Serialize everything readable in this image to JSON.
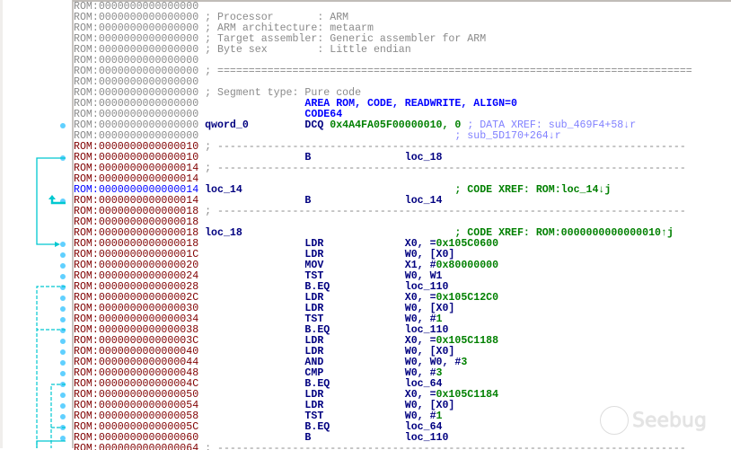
{
  "watermark": "Seebug",
  "colors": {
    "flow_arrow": "#00c8d0",
    "breakpoint_dot": "#60d0ff",
    "code_address": "#800000",
    "data_address": "#8a8a8a"
  },
  "listing": {
    "lines": [
      {
        "addr": "ROM:0000000000000000",
        "a": "gray"
      },
      {
        "addr": "ROM:0000000000000000",
        "a": "gray",
        "comment": "; Processor       : ARM"
      },
      {
        "addr": "ROM:0000000000000000",
        "a": "gray",
        "comment": "; ARM architecture: metaarm"
      },
      {
        "addr": "ROM:0000000000000000",
        "a": "gray",
        "comment": "; Target assembler: Generic assembler for ARM"
      },
      {
        "addr": "ROM:0000000000000000",
        "a": "gray",
        "comment": "; Byte sex        : Little endian"
      },
      {
        "addr": "ROM:0000000000000000",
        "a": "gray"
      },
      {
        "addr": "ROM:0000000000000000",
        "a": "gray",
        "comment": "; ============================================================================"
      },
      {
        "addr": "ROM:0000000000000000",
        "a": "gray"
      },
      {
        "addr": "ROM:0000000000000000",
        "a": "gray",
        "comment": "; Segment type: Pure code"
      },
      {
        "addr": "ROM:0000000000000000",
        "a": "gray",
        "directive": "AREA ROM, CODE, READWRITE, ALIGN=0"
      },
      {
        "addr": "ROM:0000000000000000",
        "a": "gray",
        "directive": "CODE64"
      },
      {
        "addr": "ROM:0000000000000000",
        "a": "gray",
        "label": "qword_0",
        "mnem": "DCQ",
        "data_ops": "0x4A4FA05F00000010, 0",
        "xref": "; DATA XREF: sub_469F4+58↓r",
        "xk": "xd",
        "xcol": 63
      },
      {
        "addr": "ROM:0000000000000000",
        "a": "gray",
        "xref": "; sub_5D170+264↓r",
        "xk": "xd",
        "xcol": 61
      },
      {
        "addr": "ROM:0000000000000010",
        "a": "red",
        "comment": "; ---------------------------------------------------------------------------"
      },
      {
        "addr": "ROM:0000000000000010",
        "a": "red",
        "mnem": "B",
        "ops": [
          [
            "loc_18",
            "r"
          ]
        ]
      },
      {
        "addr": "ROM:0000000000000014",
        "a": "red",
        "comment": "; ---------------------------------------------------------------------------"
      },
      {
        "addr": "ROM:0000000000000014",
        "a": "red"
      },
      {
        "addr": "ROM:0000000000000014",
        "a": "blue",
        "label": "loc_14",
        "xref": "; CODE XREF: ROM:loc_14↓j",
        "xk": "xc",
        "xcol": 61
      },
      {
        "addr": "ROM:0000000000000014",
        "a": "red",
        "mnem": "B",
        "ops": [
          [
            "loc_14",
            "r"
          ]
        ]
      },
      {
        "addr": "ROM:0000000000000018",
        "a": "red",
        "comment": "; ---------------------------------------------------------------------------"
      },
      {
        "addr": "ROM:0000000000000018",
        "a": "red"
      },
      {
        "addr": "ROM:0000000000000018",
        "a": "red",
        "label": "loc_18",
        "xref": "; CODE XREF: ROM:0000000000000010↑j",
        "xk": "xc",
        "xcol": 61
      },
      {
        "addr": "ROM:0000000000000018",
        "a": "red",
        "mnem": "LDR",
        "ops": [
          [
            "X0, =",
            "r"
          ],
          [
            "0x105C0600",
            "n"
          ]
        ]
      },
      {
        "addr": "ROM:000000000000001C",
        "a": "red",
        "mnem": "LDR",
        "ops": [
          [
            "W0, [X0]",
            "r"
          ]
        ]
      },
      {
        "addr": "ROM:0000000000000020",
        "a": "red",
        "mnem": "MOV",
        "ops": [
          [
            "X1, #",
            "r"
          ],
          [
            "0x80000000",
            "n"
          ]
        ]
      },
      {
        "addr": "ROM:0000000000000024",
        "a": "red",
        "mnem": "TST",
        "ops": [
          [
            "W0, W1",
            "r"
          ]
        ]
      },
      {
        "addr": "ROM:0000000000000028",
        "a": "red",
        "mnem": "B.EQ",
        "ops": [
          [
            "loc_110",
            "r"
          ]
        ]
      },
      {
        "addr": "ROM:000000000000002C",
        "a": "red",
        "mnem": "LDR",
        "ops": [
          [
            "X0, =",
            "r"
          ],
          [
            "0x105C12C0",
            "n"
          ]
        ]
      },
      {
        "addr": "ROM:0000000000000030",
        "a": "red",
        "mnem": "LDR",
        "ops": [
          [
            "W0, [X0]",
            "r"
          ]
        ]
      },
      {
        "addr": "ROM:0000000000000034",
        "a": "red",
        "mnem": "TST",
        "ops": [
          [
            "W0, #",
            "r"
          ],
          [
            "1",
            "n"
          ]
        ]
      },
      {
        "addr": "ROM:0000000000000038",
        "a": "red",
        "mnem": "B.EQ",
        "ops": [
          [
            "loc_110",
            "r"
          ]
        ]
      },
      {
        "addr": "ROM:000000000000003C",
        "a": "red",
        "mnem": "LDR",
        "ops": [
          [
            "X0, =",
            "r"
          ],
          [
            "0x105C1188",
            "n"
          ]
        ]
      },
      {
        "addr": "ROM:0000000000000040",
        "a": "red",
        "mnem": "LDR",
        "ops": [
          [
            "W0, [X0]",
            "r"
          ]
        ]
      },
      {
        "addr": "ROM:0000000000000044",
        "a": "red",
        "mnem": "AND",
        "ops": [
          [
            "W0, W0, #",
            "r"
          ],
          [
            "3",
            "n"
          ]
        ]
      },
      {
        "addr": "ROM:0000000000000048",
        "a": "red",
        "mnem": "CMP",
        "ops": [
          [
            "W0, #",
            "r"
          ],
          [
            "3",
            "n"
          ]
        ]
      },
      {
        "addr": "ROM:000000000000004C",
        "a": "red",
        "mnem": "B.EQ",
        "ops": [
          [
            "loc_64",
            "r"
          ]
        ]
      },
      {
        "addr": "ROM:0000000000000050",
        "a": "red",
        "mnem": "LDR",
        "ops": [
          [
            "X0, =",
            "r"
          ],
          [
            "0x105C1184",
            "n"
          ]
        ]
      },
      {
        "addr": "ROM:0000000000000054",
        "a": "red",
        "mnem": "LDR",
        "ops": [
          [
            "W0, [X0]",
            "r"
          ]
        ]
      },
      {
        "addr": "ROM:0000000000000058",
        "a": "red",
        "mnem": "TST",
        "ops": [
          [
            "W0, #",
            "r"
          ],
          [
            "1",
            "n"
          ]
        ]
      },
      {
        "addr": "ROM:000000000000005C",
        "a": "red",
        "mnem": "B.EQ",
        "ops": [
          [
            "loc_64",
            "r"
          ]
        ]
      },
      {
        "addr": "ROM:0000000000000060",
        "a": "red",
        "mnem": "B",
        "ops": [
          [
            "loc_110",
            "r"
          ]
        ]
      },
      {
        "addr": "ROM:0000000000000064",
        "a": "red",
        "comment": "; ---------------------------------------------------------------------------"
      }
    ]
  }
}
